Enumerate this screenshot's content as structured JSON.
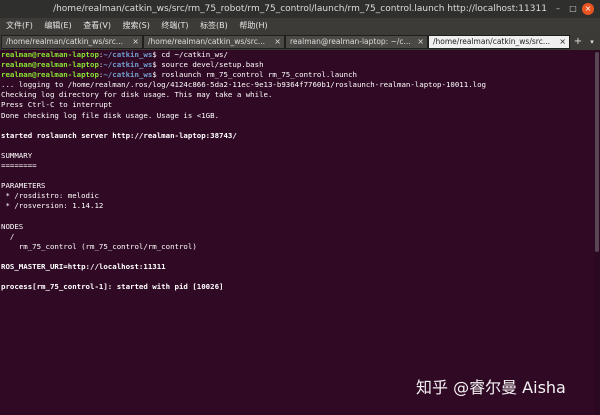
{
  "window": {
    "title": "/home/realman/catkin_ws/src/rm_75_robot/rm_75_control/launch/rm_75_control.launch http://localhost:11311",
    "controls": {
      "minimize": "–",
      "maximize": "□",
      "close": "×"
    }
  },
  "menu": [
    "文件(F)",
    "编辑(E)",
    "查看(V)",
    "搜索(S)",
    "终端(T)",
    "标签(B)",
    "帮助(H)"
  ],
  "tabs": [
    {
      "label": "/home/realman/catkin_ws/src...",
      "close": "×",
      "active": false
    },
    {
      "label": "/home/realman/catkin_ws/src...",
      "close": "×",
      "active": false
    },
    {
      "label": "realman@realman-laptop: ~/c...",
      "close": "×",
      "active": false
    },
    {
      "label": "/home/realman/catkin_ws/src...",
      "close": "×",
      "active": true
    }
  ],
  "tab_actions": {
    "add": "+",
    "menu": "▾"
  },
  "terminal": {
    "lines": [
      {
        "user": "realman@realman-laptop",
        "sep": ":",
        "path": "~/catkin_ws",
        "cmd": "$ cd ~/catkin_ws/"
      },
      {
        "user": "realman@realman-laptop",
        "sep": ":",
        "path": "~/catkin_ws",
        "cmd": "$ source devel/setup.bash"
      },
      {
        "user": "realman@realman-laptop",
        "sep": ":",
        "path": "~/catkin_ws",
        "cmd": "$ roslaunch rm_75_control rm_75_control.launch"
      },
      {
        "text": "... logging to /home/realman/.ros/log/4124c866-5da2-11ec-9e13-b9364f7760b1/roslaunch-realman-laptop-10011.log"
      },
      {
        "text": "Checking log directory for disk usage. This may take a while."
      },
      {
        "text": "Press Ctrl-C to interrupt"
      },
      {
        "text": "Done checking log file disk usage. Usage is <1GB."
      },
      {
        "text": ""
      },
      {
        "text": "started roslaunch server http://realman-laptop:38743/",
        "bold": true
      },
      {
        "text": ""
      },
      {
        "text": "SUMMARY"
      },
      {
        "text": "========"
      },
      {
        "text": ""
      },
      {
        "text": "PARAMETERS"
      },
      {
        "text": " * /rosdistro: melodic"
      },
      {
        "text": " * /rosversion: 1.14.12"
      },
      {
        "text": ""
      },
      {
        "text": "NODES"
      },
      {
        "text": "  /"
      },
      {
        "text": "    rm_75_control (rm_75_control/rm_control)"
      },
      {
        "text": ""
      },
      {
        "text": "ROS_MASTER_URI=http://localhost:11311",
        "bold": true
      },
      {
        "text": ""
      },
      {
        "text": "process[rm_75_control-1]: started with pid [10026]",
        "bold": true
      }
    ]
  },
  "watermark": "知乎 @睿尔曼 Aisha",
  "colors": {
    "terminal_bg": "#300a24",
    "prompt_user": "#8ae234",
    "prompt_path": "#729fcf",
    "close_button": "#e95420"
  }
}
